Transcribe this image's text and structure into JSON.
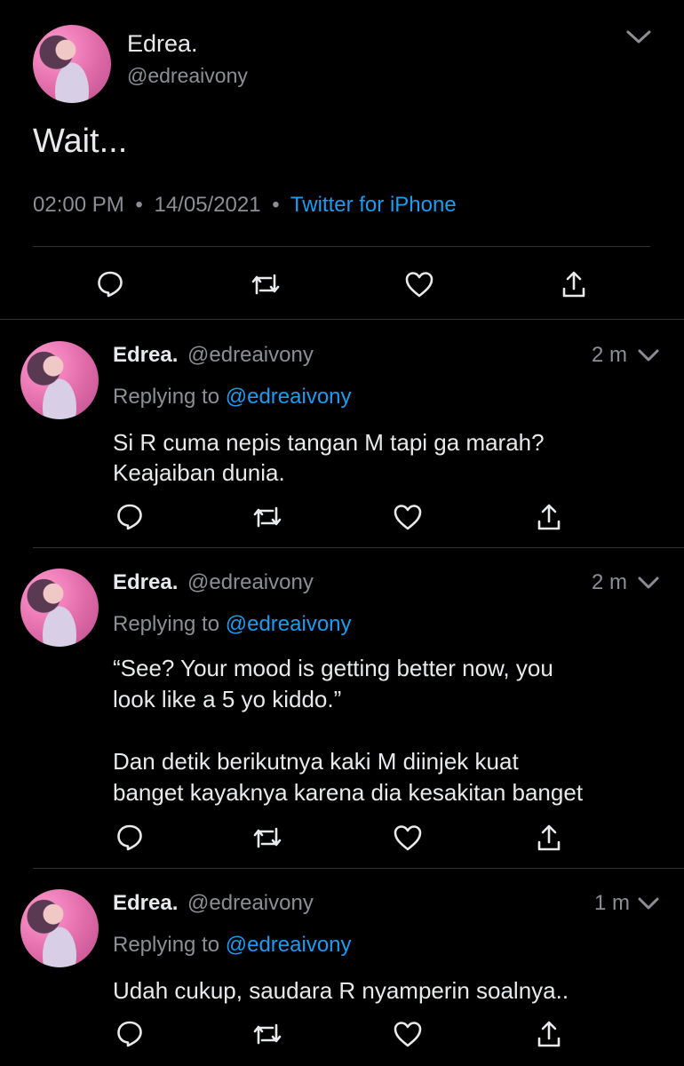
{
  "main_tweet": {
    "display_name": "Edrea.",
    "handle": "@edreaivony",
    "text": "Wait...",
    "time": "02:00 PM",
    "date": "14/05/2021",
    "source": "Twitter for iPhone",
    "separator": "•"
  },
  "replies": [
    {
      "display_name": "Edrea.",
      "handle": "@edreaivony",
      "age": "2 m",
      "replying_prefix": "Replying to",
      "replying_to": "@edreaivony",
      "text_lines": [
        "Si R cuma nepis tangan M tapi ga marah?",
        "Keajaiban dunia."
      ]
    },
    {
      "display_name": "Edrea.",
      "handle": "@edreaivony",
      "age": "2 m",
      "replying_prefix": "Replying to",
      "replying_to": "@edreaivony",
      "text_lines": [
        "“See? Your mood is getting better now, you",
        "look like a 5 yo kiddo.”",
        "",
        "Dan detik berikutnya kaki M diinjek kuat",
        "banget kayaknya karena dia kesakitan banget"
      ]
    },
    {
      "display_name": "Edrea.",
      "handle": "@edreaivony",
      "age": "1 m",
      "replying_prefix": "Replying to",
      "replying_to": "@edreaivony",
      "text_lines": [
        "Udah cukup, saudara R nyamperin soalnya.."
      ]
    }
  ],
  "icons": [
    "reply-icon",
    "retweet-icon",
    "like-icon",
    "share-icon",
    "chevron-down-icon"
  ],
  "colors": {
    "background": "#000000",
    "link": "#1d9bf0",
    "secondary_text": "#8b8f94",
    "divider": "#2f3336"
  }
}
